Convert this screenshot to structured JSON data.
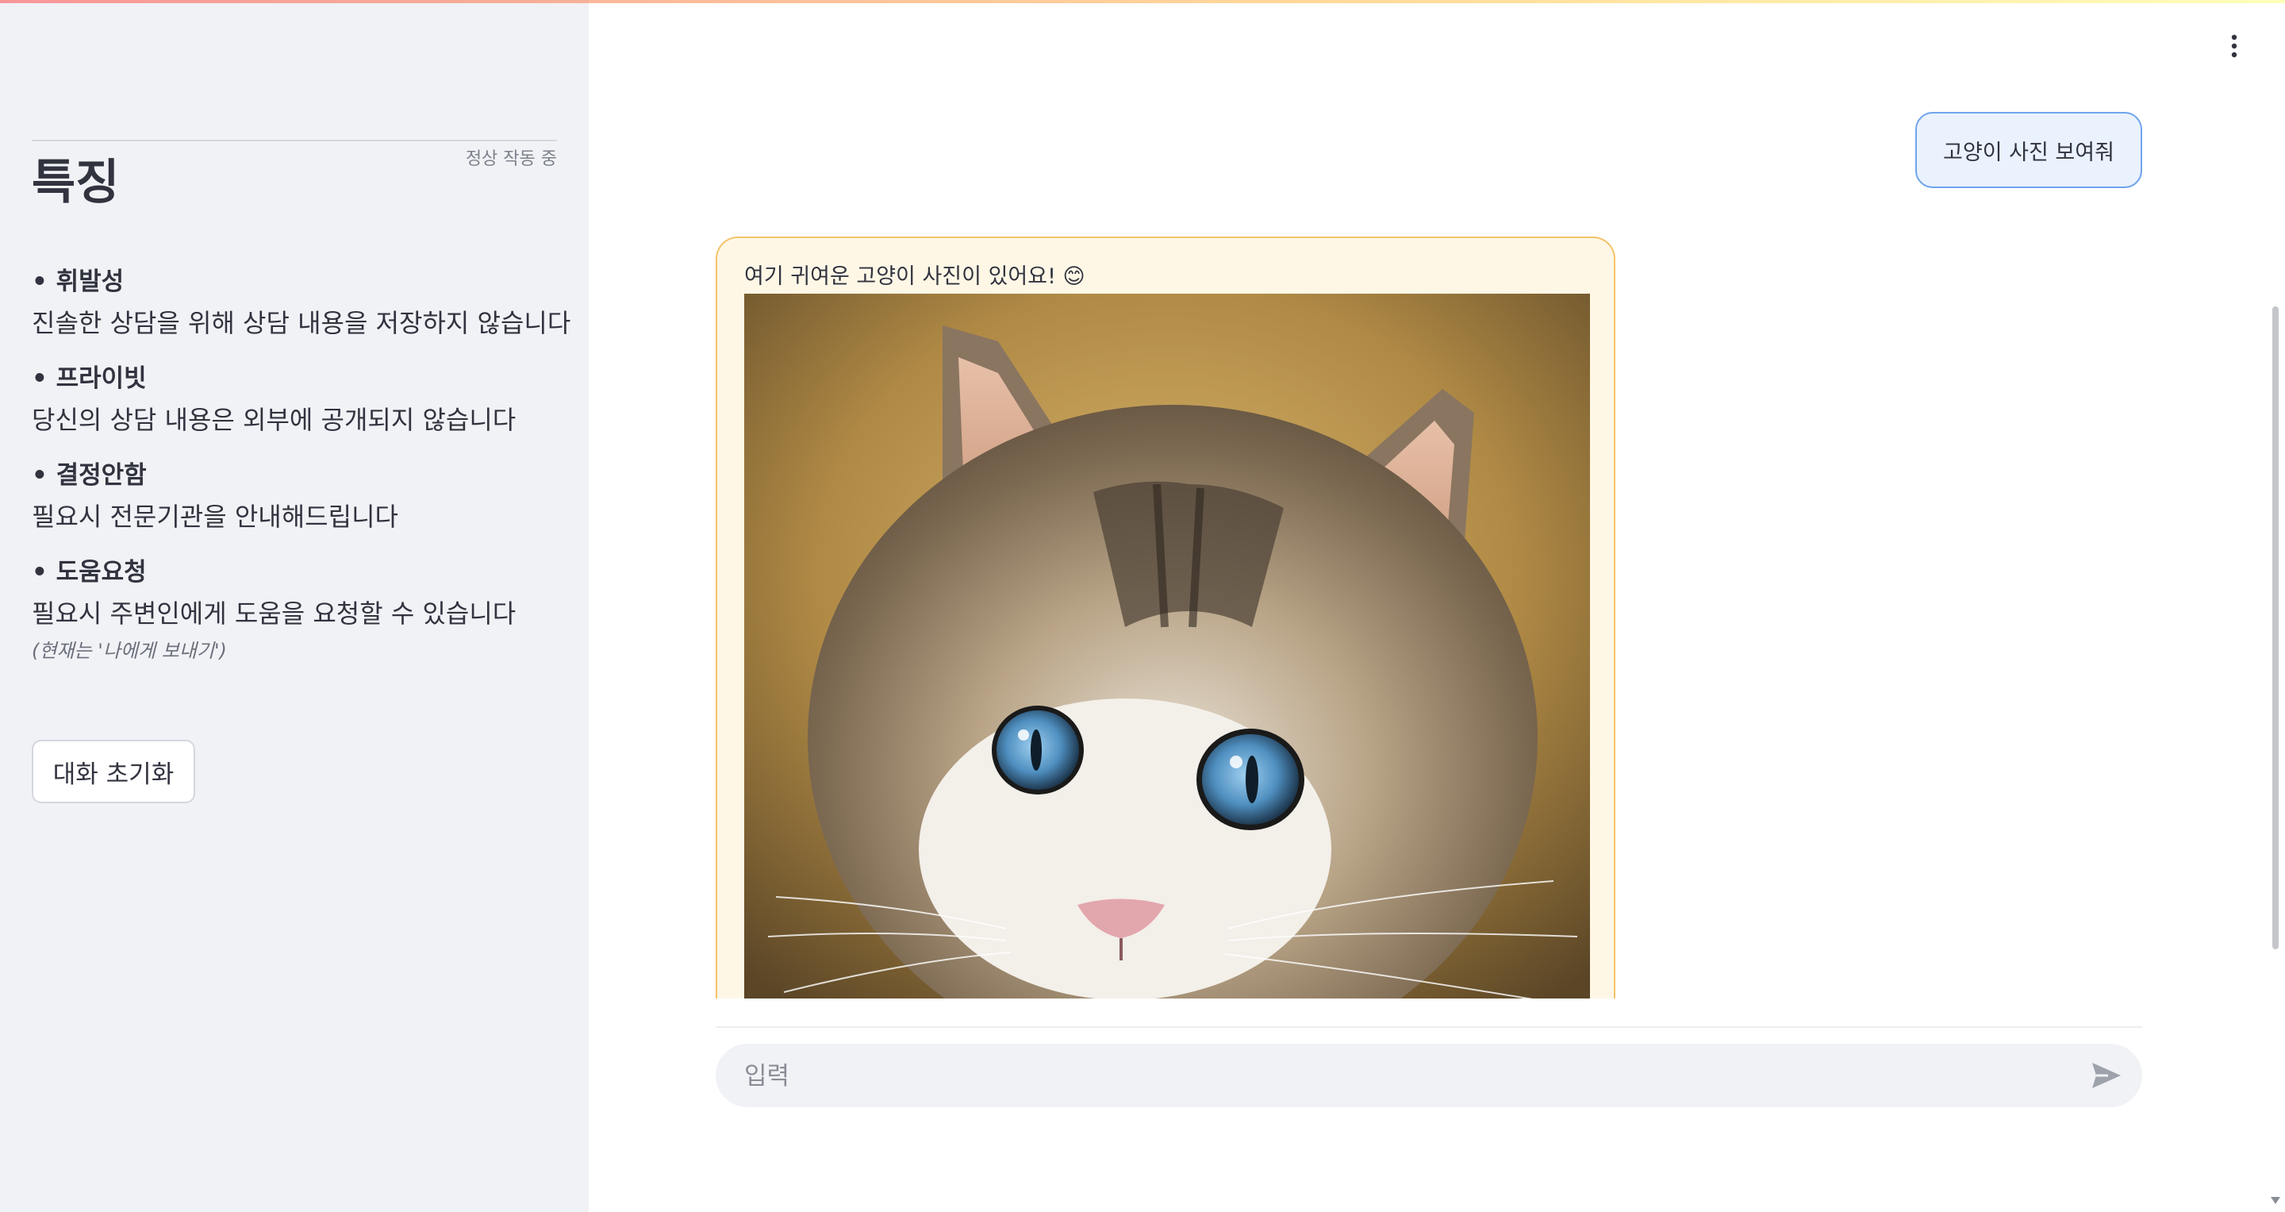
{
  "sidebar": {
    "status": "정상 작동 중",
    "title": "특징",
    "features": [
      {
        "name": "• 휘발성",
        "desc": "진솔한 상담을 위해 상담 내용을 저장하지 않습니다"
      },
      {
        "name": "• 프라이빗",
        "desc": "당신의 상담 내용은 외부에 공개되지 않습니다"
      },
      {
        "name": "• 결정안함",
        "desc": "필요시 전문기관을 안내해드립니다"
      },
      {
        "name": "• 도움요청",
        "desc": "필요시 주변인에게 도움을 요청할 수 있습니다",
        "note": "(현재는 '나에게 보내기')"
      }
    ],
    "reset_button": "대화 초기화"
  },
  "chat": {
    "messages": [
      {
        "role": "user",
        "text": "고양이 사진 보여줘"
      },
      {
        "role": "assistant",
        "text": "여기 귀여운 고양이 사진이 있어요! 😊",
        "image": "cat-photo"
      }
    ],
    "input": {
      "placeholder": "입력",
      "value": ""
    }
  },
  "icons": {
    "menu": "more-vertical-icon",
    "send": "send-icon"
  },
  "colors": {
    "sidebar_bg": "#f0f2f6",
    "user_bubble_bg": "#eaf2fd",
    "user_bubble_border": "#6fa4ee",
    "bot_bubble_bg": "#fff7e6",
    "bot_bubble_border": "#f3c36a"
  }
}
